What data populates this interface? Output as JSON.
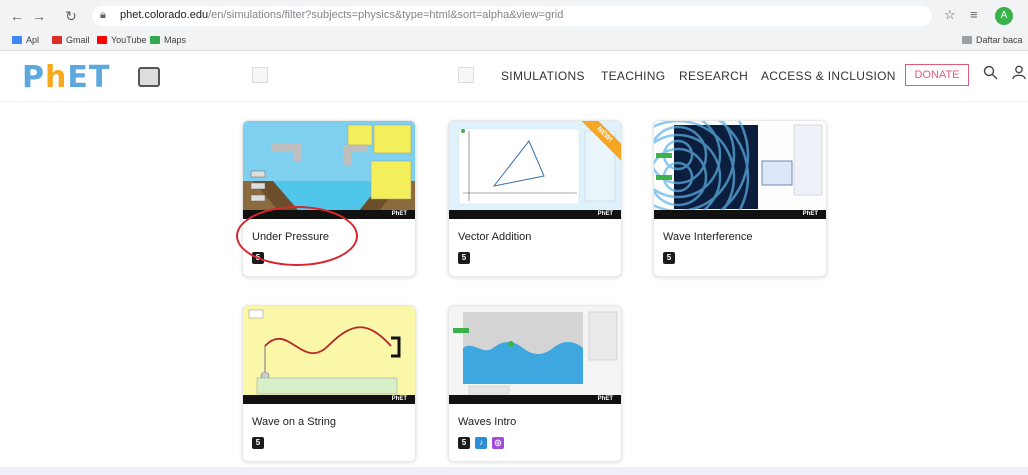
{
  "browser": {
    "url_host": "phet.colorado.edu",
    "url_path": "/en/simulations/filter?subjects=physics&type=html&sort=alpha&view=grid",
    "profile_initial": "A",
    "bookmarks": [
      {
        "label": "Apl",
        "icon": "apps-icon",
        "color": "#4285f4"
      },
      {
        "label": "Gmail",
        "icon": "gmail-icon",
        "color": "#d93025"
      },
      {
        "label": "YouTube",
        "icon": "youtube-icon",
        "color": "#ff0000"
      },
      {
        "label": "Maps",
        "icon": "maps-icon",
        "color": "#34a853"
      }
    ],
    "reading_list": "Daftar baca"
  },
  "header": {
    "logo_p": "P",
    "logo_h": "h",
    "logo_rest": "ET",
    "nav": [
      "SIMULATIONS",
      "TEACHING",
      "RESEARCH",
      "ACCESS & INCLUSION"
    ],
    "donate": "DONATE"
  },
  "simulations": [
    {
      "title": "Under Pressure",
      "badges": [
        "5"
      ],
      "highlighted": true
    },
    {
      "title": "Vector Addition",
      "badges": [
        "5"
      ],
      "ribbon": "NEW!"
    },
    {
      "title": "Wave Interference",
      "badges": [
        "5"
      ]
    },
    {
      "title": "Wave on a String",
      "badges": [
        "5"
      ]
    },
    {
      "title": "Waves Intro",
      "badges": [
        "5",
        "♪",
        "◎"
      ]
    }
  ],
  "colors": {
    "logo_blue": "#5da8dd",
    "logo_orange": "#f7a81b",
    "donate": "#e05a7c",
    "highlight": "#d7262e"
  }
}
